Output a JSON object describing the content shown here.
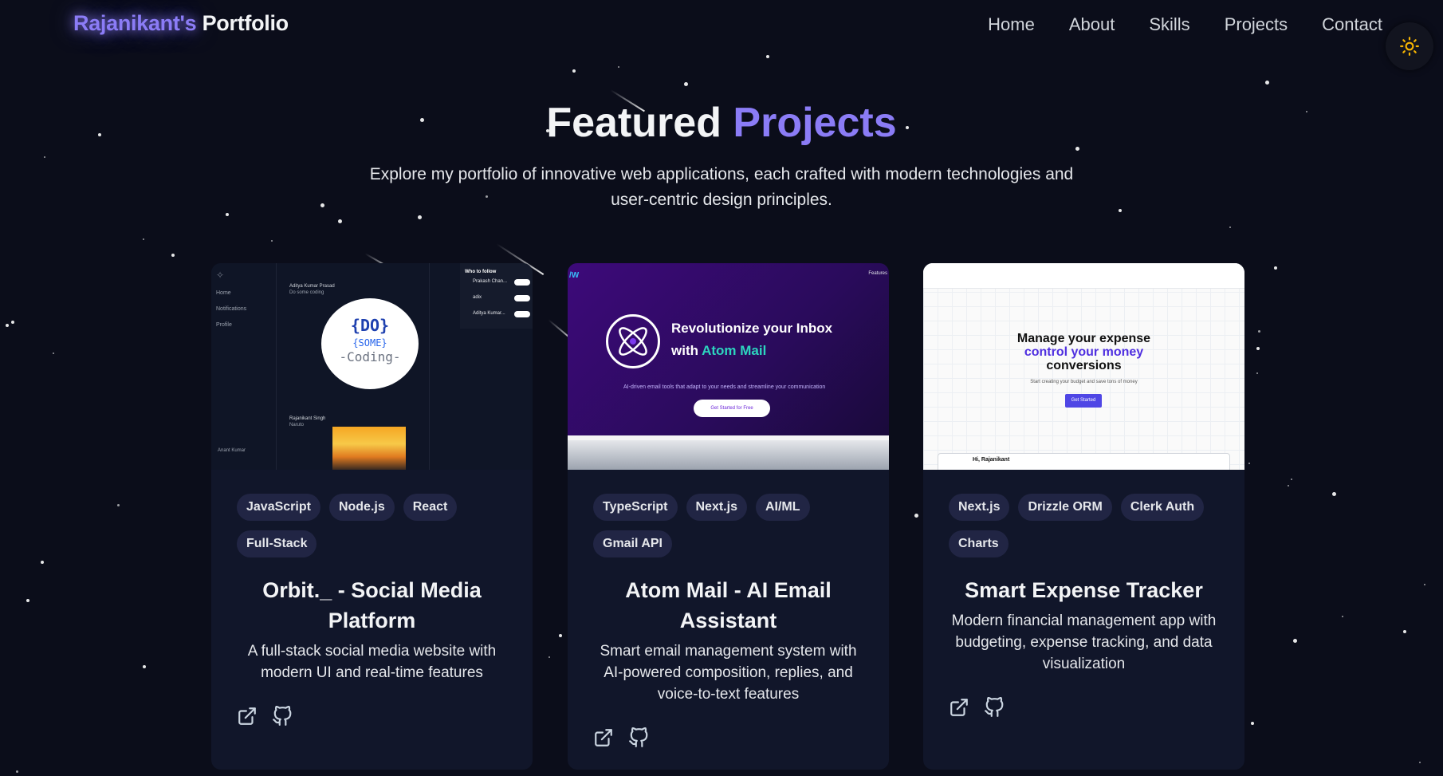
{
  "nav": {
    "brand_accent": "Rajanikant's",
    "brand_rest": " Portfolio",
    "links": [
      "Home",
      "About",
      "Skills",
      "Projects",
      "Contact"
    ],
    "theme_icon": "sun-icon"
  },
  "hero": {
    "title_part1": "Featured ",
    "title_part2": "Projects",
    "subtitle": "Explore my portfolio of innovative web applications, each crafted with modern technologies and user-centric design principles."
  },
  "colors": {
    "background": "#0b0d1a",
    "accent": "#8b7cf6",
    "card": "#11162a",
    "tag": "#212544"
  },
  "projects": [
    {
      "tags": [
        "JavaScript",
        "Node.js",
        "React",
        "Full-Stack"
      ],
      "title": "Orbit._ - Social Media Platform",
      "description": "A full-stack social media website with modern UI and real-time features",
      "preview": {
        "side_items": [
          "Home",
          "Notifications",
          "Profile"
        ],
        "post_author": "Aditya Kumar Prasad",
        "post_text": "Do some coding",
        "logo_line1": "{DO}",
        "logo_line2": "{SOME}",
        "logo_line3": "-Coding-",
        "post2_author": "Rajanikant Singh",
        "post2_text": "Naruto",
        "who_to_follow": "Who to follow",
        "follow_users": [
          "Prakash Chan...",
          "adix",
          "Aditya Kumar..."
        ],
        "follow_label": "Follow",
        "user_footer": "Anant Kumar"
      }
    },
    {
      "tags": [
        "TypeScript",
        "Next.js",
        "AI/ML",
        "Gmail API"
      ],
      "title": "Atom Mail - AI Email Assistant",
      "description": "Smart email management system with AI-powered composition, replies, and voice-to-text features",
      "preview": {
        "brand": "/W",
        "nav": "Features",
        "headline1": "Revolutionize your Inbox",
        "headline2_prefix": "with ",
        "headline2_accent": "Atom Mail",
        "sub": "AI-driven email tools that adapt to your needs and streamline your communication",
        "cta": "Get Started for Free"
      }
    },
    {
      "tags": [
        "Next.js",
        "Drizzle ORM",
        "Clerk Auth",
        "Charts"
      ],
      "title": "Smart Expense Tracker",
      "description": "Modern financial management app with budgeting, expense tracking, and data visualization",
      "preview": {
        "line1": "Manage your expense",
        "line2": "control your money",
        "line3": "conversions",
        "sub": "Start creating your budget and save tons of money",
        "cta": "Get Started",
        "greeting": "Hi, Rajanikant"
      }
    }
  ]
}
